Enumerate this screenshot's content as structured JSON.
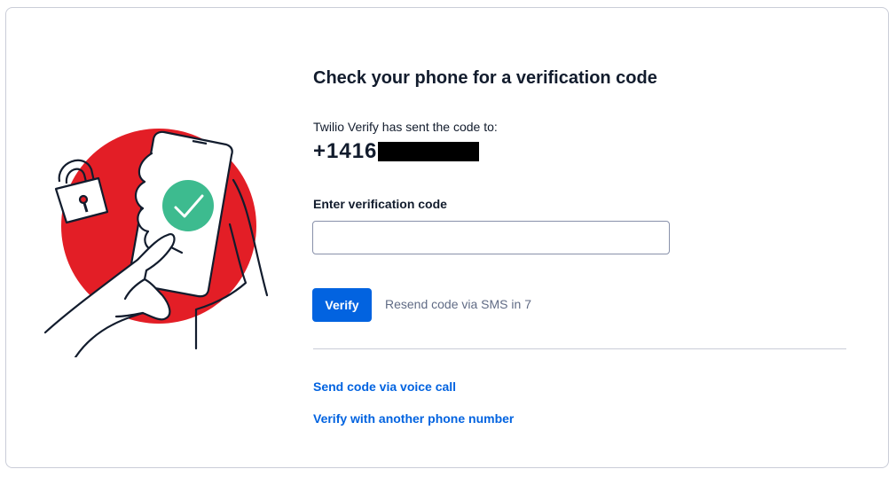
{
  "page": {
    "title": "Check your phone for a verification code",
    "sent_label": "Twilio Verify has sent the code to:",
    "phone_number_visible": "+1416",
    "field_label": "Enter verification code",
    "code_input": {
      "value": "",
      "placeholder": ""
    },
    "verify_button": "Verify",
    "resend_text": "Resend code via SMS in 7",
    "links": {
      "voice_call": "Send code via voice call",
      "another_number": "Verify with another phone number"
    }
  },
  "illustration": {
    "icons": [
      "padlock-icon",
      "phone-icon",
      "checkmark-icon",
      "hand-icon"
    ],
    "colors": {
      "circle": "#e31e26",
      "check_badge": "#3dbb8f",
      "outline": "#121c2d"
    }
  },
  "colors": {
    "primary": "#0263e0",
    "text": "#121c2d",
    "muted_text": "#606b85",
    "border": "#cacdd8",
    "input_border": "#8891aa"
  }
}
